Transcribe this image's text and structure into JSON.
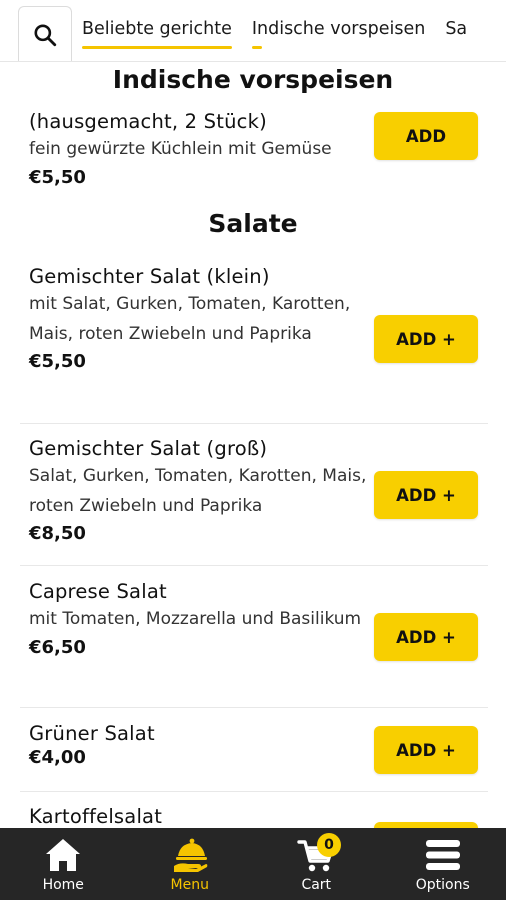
{
  "colors": {
    "accent": "#f8cf00",
    "nav_bg": "#262626"
  },
  "topbar": {
    "search_icon": "search-icon",
    "tabs": [
      {
        "label": "Beliebte gerichte"
      },
      {
        "label": "Indische vorspeisen"
      },
      {
        "label": "Sa"
      }
    ]
  },
  "sections": [
    {
      "title": "Indische vorspeisen",
      "items": [
        {
          "name": "(hausgemacht, 2 Stück)",
          "desc": "fein gewürzte Küchlein mit Gemüse",
          "price": "€5,50",
          "button": "ADD"
        }
      ]
    },
    {
      "title": "Salate",
      "items": [
        {
          "name": "Gemischter Salat (klein)",
          "desc": "mit Salat, Gurken, Tomaten, Karotten, Mais, roten Zwiebeln und Paprika",
          "price": "€5,50",
          "button": "ADD +"
        },
        {
          "name": "Gemischter Salat (groß)",
          "desc": "Salat, Gurken, Tomaten, Karotten, Mais, roten Zwiebeln und Paprika",
          "price": "€8,50",
          "button": "ADD +"
        },
        {
          "name": "Caprese Salat",
          "desc": "mit Tomaten, Mozzarella und Basilikum",
          "price": "€6,50",
          "button": "ADD +"
        },
        {
          "name": "Grüner Salat",
          "desc": "",
          "price": "€4,00",
          "button": "ADD +"
        },
        {
          "name": "Kartoffelsalat",
          "desc": "",
          "price": "",
          "button": ""
        }
      ]
    }
  ],
  "bottomnav": {
    "items": [
      {
        "label": "Home",
        "icon": "home-icon"
      },
      {
        "label": "Menu",
        "icon": "menu-cloche-icon"
      },
      {
        "label": "Cart",
        "icon": "cart-icon",
        "badge": "0"
      },
      {
        "label": "Options",
        "icon": "options-icon"
      }
    ]
  }
}
